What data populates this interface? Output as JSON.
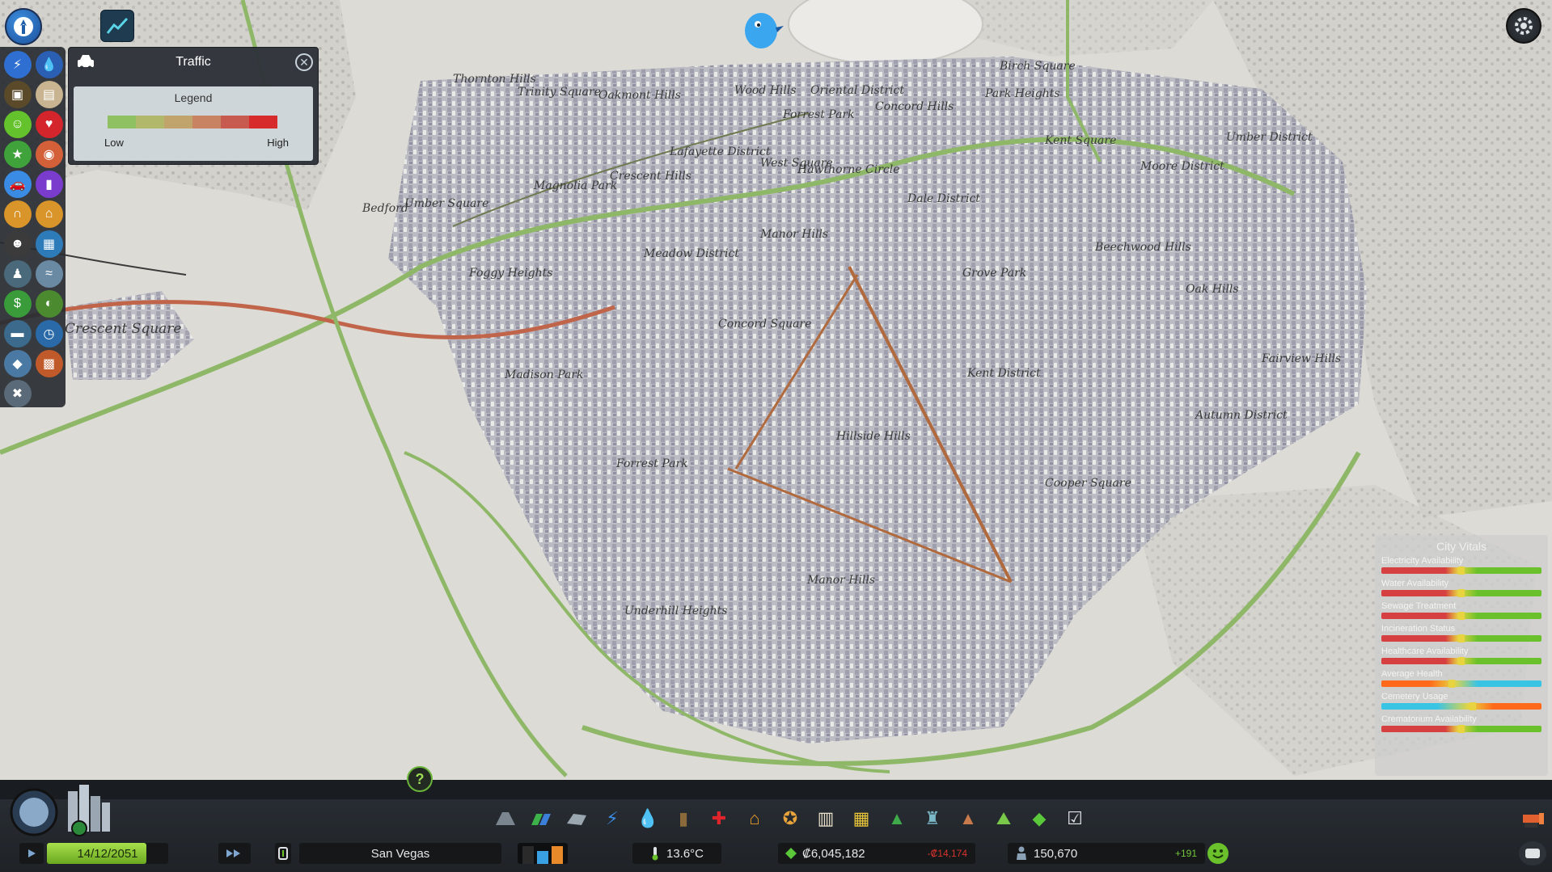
{
  "traffic_panel": {
    "title": "Traffic",
    "legend_title": "Legend",
    "legend_low": "Low",
    "legend_high": "High",
    "legend_colors": [
      "#8fc163",
      "#b1b86c",
      "#c1a46b",
      "#c88462",
      "#c75b4f",
      "#d72a2a"
    ]
  },
  "districts": [
    "Thornton Hills",
    "Trinity Square",
    "Oakmont Hills",
    "Wood Hills",
    "Oriental District",
    "Birch Square",
    "Park Heights",
    "Concord Hills",
    "Forrest Park",
    "Kent Square",
    "Umber District",
    "Moore District",
    "Lafayette District",
    "West Square",
    "Hawthorne Circle",
    "Crescent Hills",
    "Magnolia Park",
    "Bedford",
    "Umber Square",
    "Dale District",
    "Manor Hills",
    "Meadow District",
    "Beechwood Hills",
    "Foggy Heights",
    "Grove Park",
    "Oak Hills",
    "Crescent Square",
    "Concord Square",
    "Fairview Hills",
    "Madison Park",
    "Kent District",
    "Autumn District",
    "Hillside Hills",
    "Forrest Park",
    "Cooper Square",
    "Manor Hills",
    "Underhill Heights"
  ],
  "city_vitals": {
    "title": "City Vitals",
    "items": [
      {
        "label": "Electricity Availability",
        "marker": 0.48
      },
      {
        "label": "Water Availability",
        "marker": 0.48
      },
      {
        "label": "Sewage Treatment",
        "marker": 0.48
      },
      {
        "label": "Incineration Status",
        "marker": 0.48
      },
      {
        "label": "Healthcare Availability",
        "marker": 0.48
      },
      {
        "label": "Average Health",
        "marker": 0.42
      },
      {
        "label": "Cemetery Usage",
        "marker": 0.55
      },
      {
        "label": "Crematorium Availability",
        "marker": 0.48
      }
    ]
  },
  "status_bar": {
    "date": "14/12/2051",
    "date_progress": 0.82,
    "city_name": "San Vegas",
    "temperature": "13.6°C",
    "money": "₡6,045,182",
    "money_delta": "-₡14,174",
    "population": "150,670",
    "population_delta": "+191"
  },
  "help": "?",
  "icons": {
    "chirper": "chirper-icon",
    "info_views": "graph-icon",
    "settings": "gear-icon",
    "traffic": "car-icon",
    "close": "close-icon"
  }
}
